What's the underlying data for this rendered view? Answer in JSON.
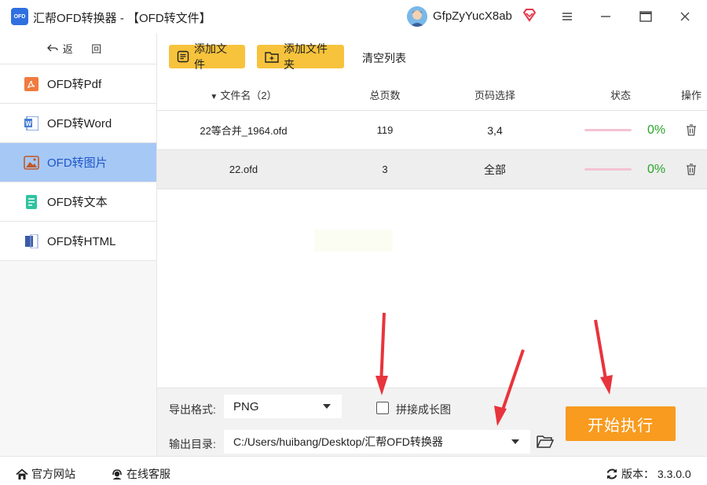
{
  "app": {
    "logo_text": "OFD",
    "title": "汇帮OFD转换器 - 【OFD转文件】",
    "user_name": "GfpZyYucX8ab",
    "accent": "#2f6fe0"
  },
  "sidebar": {
    "back_label": "返 回",
    "items": [
      {
        "label": "OFD转Pdf",
        "icon": "pdf-icon",
        "active": false
      },
      {
        "label": "OFD转Word",
        "icon": "word-icon",
        "active": false
      },
      {
        "label": "OFD转图片",
        "icon": "image-icon",
        "active": true
      },
      {
        "label": "OFD转文本",
        "icon": "text-file-icon",
        "active": false
      },
      {
        "label": "OFD转HTML",
        "icon": "html-icon",
        "active": false
      }
    ]
  },
  "toolbar": {
    "add_file": "添加文件",
    "add_folder": "添加文件夹",
    "clear_list": "清空列表"
  },
  "table": {
    "headers": {
      "name": "文件名（2）",
      "pages": "总页数",
      "range": "页码选择",
      "status": "状态",
      "action": "操作"
    },
    "rows": [
      {
        "name": "22等合并_1964.ofd",
        "pages": "119",
        "range": "3,4",
        "progress": "0%",
        "progress_value": 0
      },
      {
        "name": "22.ofd",
        "pages": "3",
        "range": "全部",
        "progress": "0%",
        "progress_value": 0
      }
    ]
  },
  "bottom": {
    "format_label": "导出格式:",
    "format_value": "PNG",
    "merge_label": "拼接成长图",
    "merge_checked": false,
    "output_label": "输出目录:",
    "output_value": "C:/Users/huibang/Desktop/汇帮OFD转换器",
    "start_label": "开始执行"
  },
  "statusbar": {
    "website": "官方网站",
    "support": "在线客服",
    "version": "版本： 3.3.0.0"
  },
  "colors": {
    "sidebar_active": "#a6c8f5",
    "button_yellow": "#f7c33c",
    "start_orange": "#f89b1f",
    "progress_green": "#2aa52a",
    "annotation_red": "#e8343c"
  }
}
